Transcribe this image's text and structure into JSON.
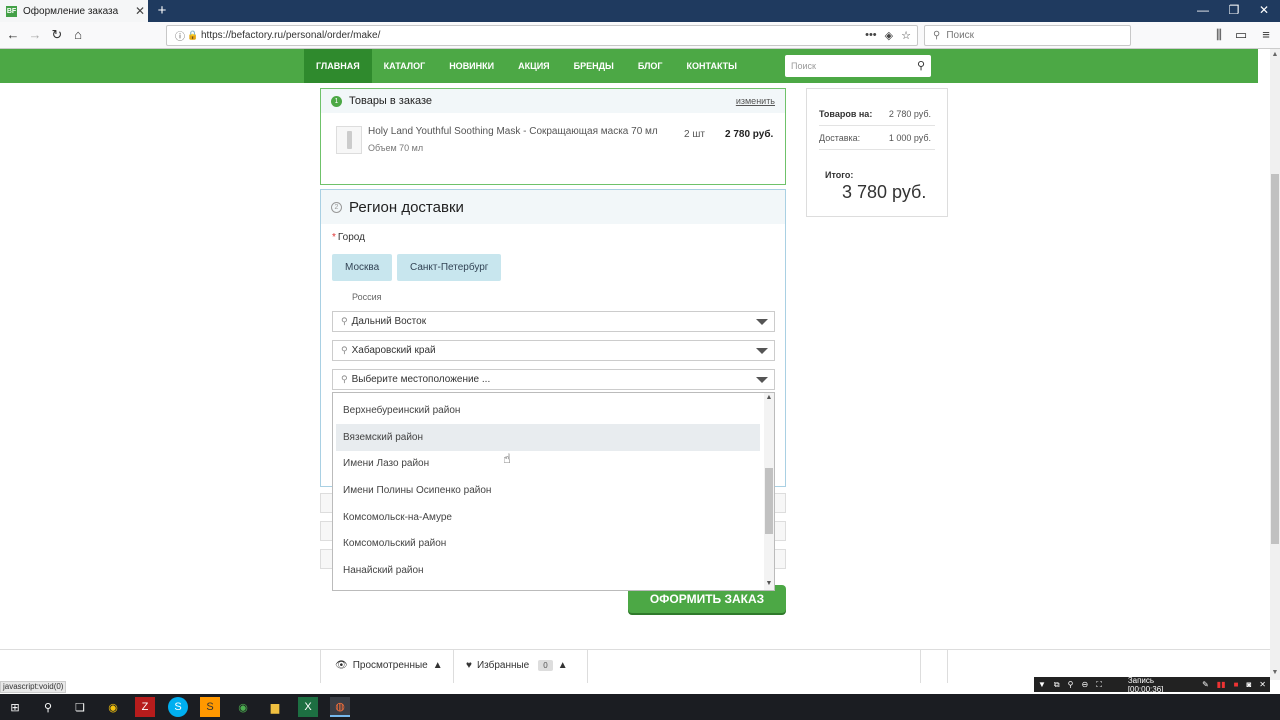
{
  "browser": {
    "tab_title": "Оформление заказа",
    "tab_favicon": "BF",
    "url": "https://befactory.ru/personal/order/make/",
    "search_placeholder": "Поиск"
  },
  "site_nav": {
    "items": [
      {
        "label": "ГЛАВНАЯ",
        "active": true
      },
      {
        "label": "КАТАЛОГ"
      },
      {
        "label": "НОВИНКИ"
      },
      {
        "label": "АКЦИЯ"
      },
      {
        "label": "БРЕНДЫ"
      },
      {
        "label": "БЛОГ"
      },
      {
        "label": "КОНТАКТЫ"
      }
    ],
    "search_placeholder": "Поиск"
  },
  "order": {
    "step1_num": "1",
    "step1_title": "Товары в заказе",
    "change_label": "изменить",
    "product": {
      "name": "Holy Land Youthful Soothing Mask - Сокращающая маска 70 мл",
      "volume": "Объем 70 мл",
      "qty": "2 шт",
      "price": "2 780 руб."
    },
    "step2_num": "2",
    "step2_title": "Регион доставки",
    "city_label": "Город",
    "city_buttons": [
      "Москва",
      "Санкт-Петербург"
    ],
    "country": "Россия",
    "region": "Дальний Восток",
    "subregion": "Хабаровский край",
    "location_placeholder": "Выберите местоположение ...",
    "dropdown_items": [
      "Верхнебуреинский район",
      "Вяземский район",
      "Имени Лазо район",
      "Имени Полины Осипенко район",
      "Комсомольск-на-Амуре",
      "Комсомольский район",
      "Нанайский район"
    ],
    "submit_label": "ОФОРМИТЬ ЗАКАЗ"
  },
  "summary": {
    "goods_label": "Товаров на:",
    "goods_value": "2 780 руб.",
    "delivery_label": "Доставка:",
    "delivery_value": "1 000 руб.",
    "total_label": "Итого:",
    "total_value": "3 780 руб."
  },
  "bottom_panel": {
    "viewed_label": "Просмотренные",
    "favorites_label": "Избранные",
    "favorites_count": "0"
  },
  "status_text": "javascript:void(0)",
  "recording": {
    "label": "Запись [00:00:36]"
  }
}
